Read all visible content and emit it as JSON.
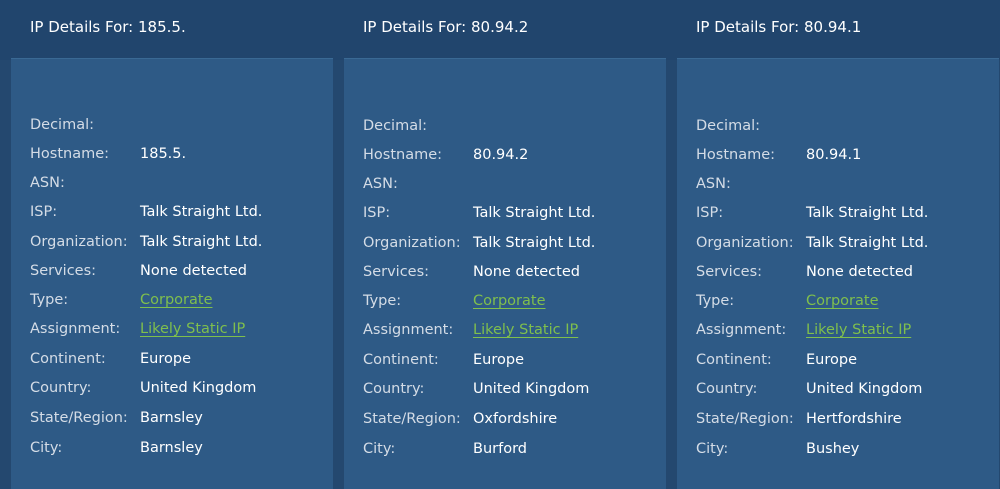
{
  "panels": [
    {
      "title": "IP Details For: 185.5.",
      "fields": [
        {
          "label": "Decimal:",
          "value": ""
        },
        {
          "label": "Hostname:",
          "value": "185.5."
        },
        {
          "label": "ASN:",
          "value": ""
        },
        {
          "label": "ISP:",
          "value": "Talk Straight Ltd."
        },
        {
          "label": "Organization:",
          "value": "Talk Straight Ltd."
        },
        {
          "label": "Services:",
          "value": "None detected"
        },
        {
          "label": "Type:",
          "value": "Corporate",
          "link": true
        },
        {
          "label": "Assignment:",
          "value": "Likely Static IP",
          "link": true
        },
        {
          "label": "Continent:",
          "value": "Europe"
        },
        {
          "label": "Country:",
          "value": "United Kingdom"
        },
        {
          "label": "State/Region:",
          "value": "Barnsley"
        },
        {
          "label": "City:",
          "value": "Barnsley"
        }
      ]
    },
    {
      "title": "IP Details For: 80.94.2",
      "fields": [
        {
          "label": "Decimal:",
          "value": ""
        },
        {
          "label": "Hostname:",
          "value": "80.94.2"
        },
        {
          "label": "ASN:",
          "value": ""
        },
        {
          "label": "ISP:",
          "value": "Talk Straight Ltd."
        },
        {
          "label": "Organization:",
          "value": "Talk Straight Ltd."
        },
        {
          "label": "Services:",
          "value": "None detected"
        },
        {
          "label": "Type:",
          "value": "Corporate",
          "link": true
        },
        {
          "label": "Assignment:",
          "value": "Likely Static IP",
          "link": true
        },
        {
          "label": "Continent:",
          "value": "Europe"
        },
        {
          "label": "Country:",
          "value": "United Kingdom"
        },
        {
          "label": "State/Region:",
          "value": "Oxfordshire"
        },
        {
          "label": "City:",
          "value": "Burford"
        }
      ]
    },
    {
      "title": "IP Details For: 80.94.1",
      "fields": [
        {
          "label": "Decimal:",
          "value": ""
        },
        {
          "label": "Hostname:",
          "value": "80.94.1"
        },
        {
          "label": "ASN:",
          "value": ""
        },
        {
          "label": "ISP:",
          "value": "Talk Straight Ltd."
        },
        {
          "label": "Organization:",
          "value": "Talk Straight Ltd."
        },
        {
          "label": "Services:",
          "value": "None detected"
        },
        {
          "label": "Type:",
          "value": "Corporate",
          "link": true
        },
        {
          "label": "Assignment:",
          "value": "Likely Static IP",
          "link": true
        },
        {
          "label": "Continent:",
          "value": "Europe"
        },
        {
          "label": "Country:",
          "value": "United Kingdom"
        },
        {
          "label": "State/Region:",
          "value": "Hertfordshire"
        },
        {
          "label": "City:",
          "value": "Bushey"
        }
      ]
    }
  ]
}
